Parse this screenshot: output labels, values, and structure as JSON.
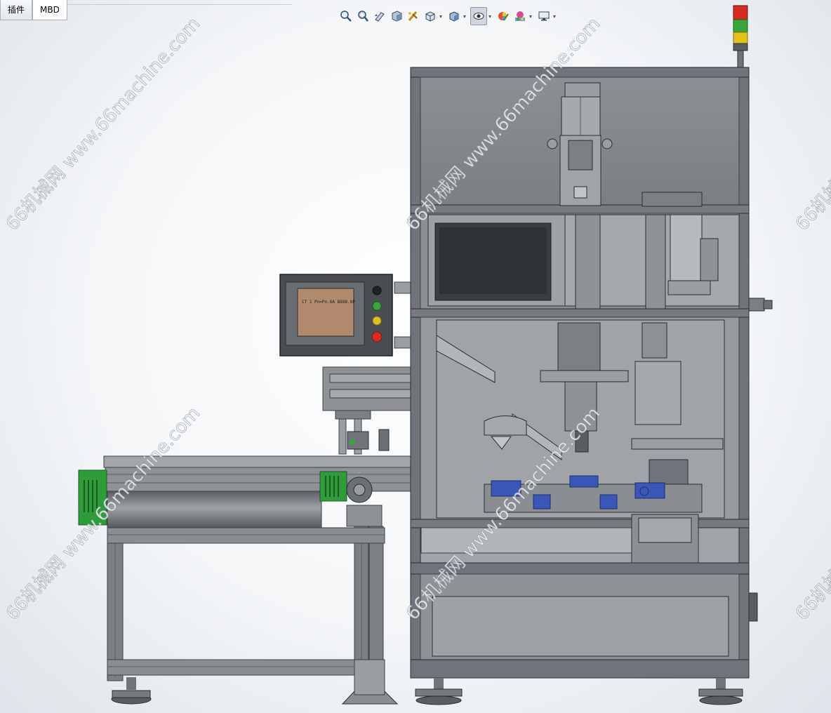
{
  "tabs": [
    {
      "label": "插件",
      "active": false
    },
    {
      "label": "MBD",
      "active": true
    }
  ],
  "toolbar": {
    "buttons": [
      {
        "name": "zoom-to-fit-icon"
      },
      {
        "name": "zoom-area-icon"
      },
      {
        "name": "previous-view-icon"
      },
      {
        "name": "section-view-icon"
      },
      {
        "name": "dynamic-annotation-icon"
      },
      {
        "name": "view-orientation-icon",
        "dropdown": true
      },
      {
        "name": "display-style-icon",
        "dropdown": true
      },
      {
        "name": "hide-show-items-icon",
        "dropdown": true,
        "pressed": true
      },
      {
        "name": "edit-appearance-icon"
      },
      {
        "name": "apply-scene-icon",
        "dropdown": true
      },
      {
        "name": "view-settings-icon",
        "dropdown": true
      }
    ]
  },
  "hmi_screen_text": "CT 1  Pn=Pn.6A  B888.8P",
  "watermark": "66机械网 www.66machine.com",
  "colors": {
    "frame": "#6f747a",
    "frame_dark": "#3e4247",
    "panel": "#8f9398",
    "panel_light": "#a7abaf",
    "green_box": "#2e9c3a",
    "blue_part": "#3a57b8",
    "hmi_screen": "#b18a6e",
    "stack_red": "#d62a22",
    "stack_yellow": "#e2c11a",
    "stack_green": "#3aa53a"
  }
}
